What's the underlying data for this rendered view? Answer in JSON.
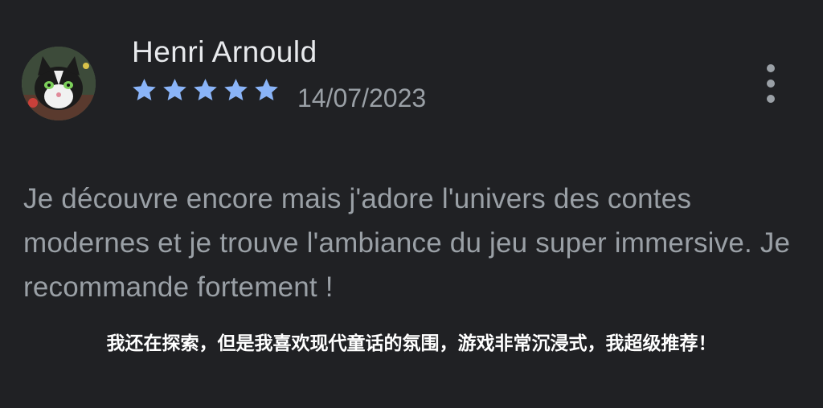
{
  "review": {
    "author_name": "Henri Arnould",
    "avatar_icon": "cat-avatar-icon",
    "rating": 5,
    "rating_max": 5,
    "star_color": "#8ab4f8",
    "date": "14/07/2023",
    "more_icon": "more-vert-icon",
    "text": "Je découvre encore mais j'adore l'univers des contes modernes et je trouve l'ambiance du jeu super immersive. Je recommande fortement !"
  },
  "translation": {
    "text": "我还在探索，但是我喜欢现代童话的氛围，游戏非常沉浸式，我超级推荐！"
  },
  "colors": {
    "background": "#202124",
    "name": "#e8eaed",
    "secondary_text": "#9aa0a6"
  }
}
